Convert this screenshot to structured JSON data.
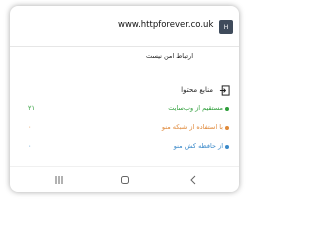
{
  "header": {
    "url": "www.httpforever.co.uk",
    "badge": "H"
  },
  "connection_status": "ارتباط امن نیست",
  "sources": {
    "title": "منابع محتوا",
    "items": [
      {
        "label": "مستقیم از وب‌سایت",
        "count": "۲۱",
        "color": "#2e9e3a"
      },
      {
        "label": "با استفاده از شبکه منو",
        "count": "۰",
        "color": "#e0893a"
      },
      {
        "label": "از حافظه کش منو",
        "count": "۰",
        "color": "#3a89c9"
      }
    ]
  },
  "colors": {
    "header_badge": "#3f4b5b",
    "icon": "#555555"
  },
  "icons": {
    "nav_menu": "recent-apps-icon",
    "nav_home": "home-icon",
    "nav_back": "back-icon"
  }
}
